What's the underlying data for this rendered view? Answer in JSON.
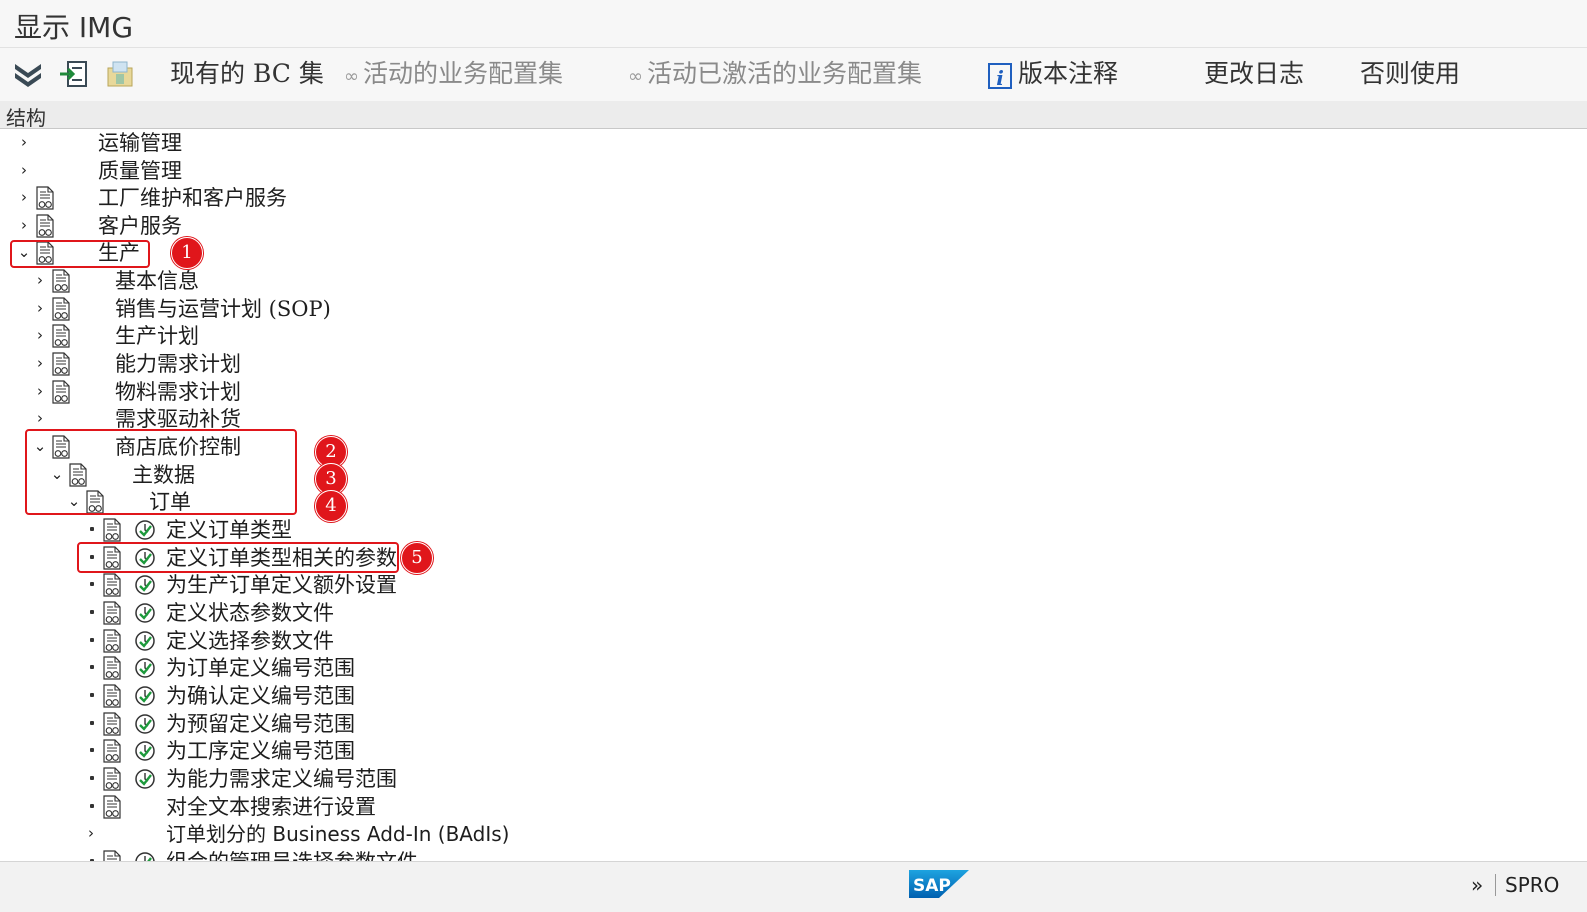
{
  "window": {
    "title": "显示 IMG"
  },
  "toolbar": {
    "expand_icon": "double-chevron-down-icon",
    "existing_bc_sets": "现有的 BC 集",
    "active_bc_sets": "活动的业务配置集",
    "activated_bc_sets": "活动已激活的业务配置集",
    "release_notes": "版本注释",
    "change_log": "更改日志",
    "where_used": "否则使用"
  },
  "structure_header": "结构",
  "tree": {
    "nodes": [
      {
        "label": "运输管理"
      },
      {
        "label": "质量管理"
      },
      {
        "label": "工厂维护和客户服务"
      },
      {
        "label": "客户服务"
      },
      {
        "label": "生产"
      },
      {
        "label": "基本信息"
      },
      {
        "label": "销售与运营计划 (SOP)"
      },
      {
        "label": "生产计划"
      },
      {
        "label": "能力需求计划"
      },
      {
        "label": "物料需求计划"
      },
      {
        "label": "需求驱动补货"
      },
      {
        "label": "商店底价控制"
      },
      {
        "label": "主数据"
      },
      {
        "label": "订单"
      },
      {
        "label": "定义订单类型"
      },
      {
        "label": "定义订单类型相关的参数"
      },
      {
        "label": "为生产订单定义额外设置"
      },
      {
        "label": "定义状态参数文件"
      },
      {
        "label": "定义选择参数文件"
      },
      {
        "label": "为订单定义编号范围"
      },
      {
        "label": "为确认定义编号范围"
      },
      {
        "label": "为预留定义编号范围"
      },
      {
        "label": "为工序定义编号范围"
      },
      {
        "label": "为能力需求定义编号范围"
      },
      {
        "label": "对全文本搜索进行设置"
      },
      {
        "label": "订单划分的 Business Add-In (BAdIs)"
      },
      {
        "label": "组合的管理员选择参数文件"
      }
    ]
  },
  "annotations": {
    "markers": [
      "1",
      "2",
      "3",
      "4",
      "5"
    ],
    "highlight_color": "#e0161b"
  },
  "status_bar": {
    "logo_text": "SAP",
    "transaction": "SPRO",
    "more_glyph": "»"
  }
}
